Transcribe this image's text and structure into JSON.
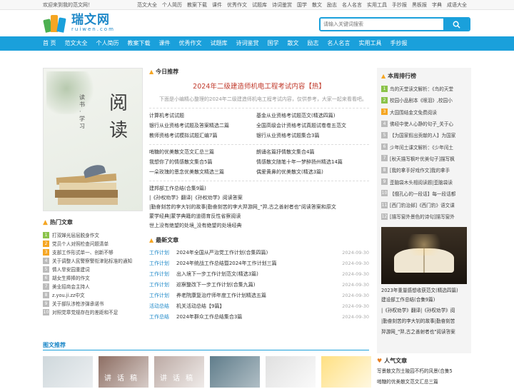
{
  "topbar": {
    "welcome": "欢迎来到我的范文网！",
    "links": [
      "范文大全",
      "个人简历",
      "教案下载",
      "课件",
      "优秀作文",
      "试题库",
      "诗词鉴赏",
      "国学",
      "散文",
      "励志",
      "名人名言",
      "实用工具",
      "手抄报",
      "黑板报",
      "字典",
      "成语大全"
    ]
  },
  "logo": {
    "name": "瑞文网",
    "domain": "ruiwen.com"
  },
  "search": {
    "placeholder": "请输入关键词搜索"
  },
  "nav": [
    "首 页",
    "范文大全",
    "个人简历",
    "教案下载",
    "课件",
    "优秀作文",
    "试题库",
    "诗词鉴赏",
    "国学",
    "散文",
    "励志",
    "名人名言",
    "实用工具",
    "手抄报"
  ],
  "left": {
    "cover": {
      "big1": "阅",
      "big2": "读",
      "small": "读书·学习"
    },
    "hot_title": "热门文章",
    "hot_items": [
      "打双婵光层层脱身作文",
      "党员个人对照检查问题清单",
      "支部工作形式单一、创新不够",
      "关于调整人民警察警衔津贴标准的通知",
      "情人旱安园重建词",
      "胡女生捧捧的作文",
      "美业招商会主持人",
      "z.you.ji.zz中文",
      "关于部队涉枪涉弹承诺书",
      "对照党章党规存在的差距和不足"
    ]
  },
  "mid": {
    "rec_title": "今日推荐",
    "headline": "2024年二级建造师机电工程考试内容【热】",
    "intro": "下面是小编精心整理的2024年二级建造师机电工程考试内容，仅供参考，大家一起来看看吧。",
    "links1": [
      "计算机考试试题",
      "基金从业资格考试题范文(精选四篇)",
      "银行从业资格考试题及答案精选二篇",
      "全国高级会计资格考试真题试卷卷五范文",
      "教师资格考试模拟试题汇编7篇",
      "银行从业资格考试题集合3篇"
    ],
    "links2": [
      "哨糖的优美散文范文汇总三篇",
      "朗诵名篇抒情散文集合4篇",
      "我想你了的情感散文集合5篇",
      "情感散文随笔十年一梦醉扬州精选14篇",
      "一朵玫瑰的恩念优美散文精选三篇",
      "偶爱黄鼻的优美散文(精选3篇)"
    ],
    "links3": [
      "建邦部工作总结(合集9篇)",
      "|《孙权劝学》翻译|《孙权劝学》阅读答案",
      "|勤奋刻苦的李大钊的故事|勤奋刻苦的李大羿游网_\"羿,古之善射者也\"阅读答案和原文",
      "蒙学经典|蒙学典籍的道德育反性省察阅读",
      "世上没有绝望的处境_没有绝望的处境经典"
    ],
    "news_title": "最新文章",
    "news": [
      {
        "cat": "工作计划",
        "title": "2024年全国从严治党工作计划(合集四篇)",
        "date": "2024-09-30"
      },
      {
        "cat": "工作计划",
        "title": "2024年统战工作总结暨2024年工作计划三篇",
        "date": "2024-09-30"
      },
      {
        "cat": "工作计划",
        "title": "出入境下一步工作计划范文(精选3篇)",
        "date": "2024-09-30"
      },
      {
        "cat": "工作计划",
        "title": "巡察整改下一步工作计划(合集九篇)",
        "date": "2024-09-30"
      },
      {
        "cat": "工作计划",
        "title": "养老院康复治疗师年度工作计划精选五篇",
        "date": "2024-09-30"
      },
      {
        "cat": "活动总结",
        "title": "机关活动总结【9篇】",
        "date": "2024-09-30"
      },
      {
        "cat": "工作总结",
        "title": "2024年群众工作总结集合3篇",
        "date": "2024-09-30"
      }
    ]
  },
  "right": {
    "rank_title": "本周排行榜",
    "rank_items": [
      "鸟的天堂读文解析：《鸟的天堂",
      "校园小品剧本《眼泪》,校园小",
      "大国围结金文免费阅读",
      "佛经中使人心静的句子_关于心",
      "【为国家假出贡献的人】为国家",
      "少年闰土课文解析：《少年闰土",
      "[秋天描写枫叶优美句子]描写枫",
      "[我的拿手好戏作文]我的拿手",
      "歪脑袋木头相阅读题|歪脑袋读",
      "【俄孔心的一段话】每一段话都",
      "[西门豹治邺]《西门豹》语文课",
      "[描写窗外景色的诗句]描写窗外"
    ],
    "img_caption": "2023年重量感想收获范文(精选四篇)",
    "links": [
      "建设部工作总结(合集9篇)",
      "|《孙权劝学》翻译|《孙权劝学》阅",
      "|勤奋刻苦的李大钊的故事|勤奋刻苦",
      "羿游网_\"羿,古之善射者也\"阅读答案"
    ],
    "pop_title": "人气文章",
    "pop_items": [
      "写景散文烈士陵园不朽的风景(合集5",
      "哨糖的优美散文范文汇总三篇"
    ]
  },
  "pics": {
    "title": "图文推荐",
    "labels": [
      "",
      "讲话稿",
      "讲话稿",
      "",
      "",
      ""
    ]
  },
  "colors": {
    "accent": "#1aa0db",
    "headline": "#c0392b"
  }
}
